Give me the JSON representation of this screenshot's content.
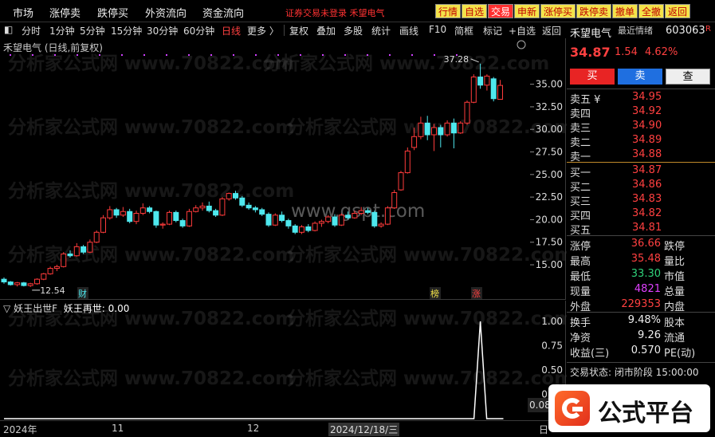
{
  "top_menu": [
    "市场",
    "涨停卖",
    "跌停买",
    "外资流向",
    "资金流向"
  ],
  "top_status": "证券交易未登录 禾望电气",
  "top_buttons": [
    {
      "label": "行情",
      "bg": "#f3e34a",
      "fg": "#c00000"
    },
    {
      "label": "自选",
      "bg": "#f3e34a",
      "fg": "#c00000"
    },
    {
      "label": "交易",
      "bg": "#ff3030",
      "fg": "#ffffff"
    },
    {
      "label": "申新",
      "bg": "#f3e34a",
      "fg": "#c00000"
    },
    {
      "label": "涨停买",
      "bg": "#f3e34a",
      "fg": "#c00000"
    },
    {
      "label": "跌停卖",
      "bg": "#f3e34a",
      "fg": "#c00000"
    },
    {
      "label": "撤单",
      "bg": "#f3e34a",
      "fg": "#c00000"
    },
    {
      "label": "全撤",
      "bg": "#f3e34a",
      "fg": "#c00000"
    },
    {
      "label": "返回",
      "bg": "#f3e34a",
      "fg": "#c00000"
    }
  ],
  "periods": [
    "分时",
    "1分钟",
    "5分钟",
    "15分钟",
    "30分钟",
    "60分钟",
    "日线",
    "更多 〉"
  ],
  "active_period": "日线",
  "tools": [
    "复权",
    "叠加",
    "多股",
    "统计",
    "画线",
    "F10",
    "简框",
    "标记",
    "+自选",
    "返回"
  ],
  "chart_title": "禾望电气 (日线,前复权)",
  "y_ticks": [
    "35.00",
    "32.50",
    "30.00",
    "27.50",
    "25.00",
    "22.50",
    "20.00",
    "17.50",
    "15.00"
  ],
  "max_label": "37.28",
  "min_label": "12.54",
  "markers": [
    {
      "text": "财",
      "color": "#4ee8ee"
    },
    {
      "text": "榜",
      "color": "#f3e34a"
    },
    {
      "text": "涨",
      "color": "#ff4040"
    }
  ],
  "indicator_title": "妖王出世F",
  "indicator_value": "妖王再世: 0.00",
  "ind_ticks": [
    "1.00",
    "0.75",
    "0.50",
    "0.25"
  ],
  "ind_bottom_value": "0.08",
  "x_labels": [
    "2024年",
    "11",
    "12",
    "2024/12/18/三"
  ],
  "x_suffix": "日",
  "watermark_1": "分析家公式网 www.70822.com",
  "watermark_2": "www.gspt.com",
  "panel": {
    "name": "禾望电气",
    "hint": "最近情绪",
    "code": "603063",
    "price": "34.87",
    "change": "1.54",
    "change_pct": "4.62%",
    "buy_btn": "买",
    "sell_btn": "卖",
    "query_btn": "查",
    "asks": [
      {
        "label": "卖五 ¥",
        "price": "34.95"
      },
      {
        "label": "卖四",
        "price": "34.92"
      },
      {
        "label": "卖三",
        "price": "34.90"
      },
      {
        "label": "卖二",
        "price": "34.89"
      },
      {
        "label": "卖一",
        "price": "34.88"
      }
    ],
    "bids": [
      {
        "label": "买一",
        "price": "34.87"
      },
      {
        "label": "买二",
        "price": "34.86"
      },
      {
        "label": "买三",
        "price": "34.83"
      },
      {
        "label": "买四",
        "price": "34.82"
      },
      {
        "label": "买五",
        "price": "34.81"
      }
    ],
    "stats": [
      {
        "label": "涨停",
        "value": "36.66",
        "color": "#ff4040",
        "label2": "跌停"
      },
      {
        "label": "最高",
        "value": "35.48",
        "color": "#ff4040",
        "label2": "量比"
      },
      {
        "label": "最低",
        "value": "33.30",
        "color": "#2fd27a",
        "label2": "市值"
      },
      {
        "label": "现量",
        "value": "4821",
        "color": "#e040ff",
        "label2": "总量"
      },
      {
        "label": "外盘",
        "value": "229353",
        "color": "#ff4040",
        "label2": "内盘"
      }
    ],
    "stats2": [
      {
        "label": "换手",
        "value": "9.48%",
        "label2": "股本"
      },
      {
        "label": "净资",
        "value": "9.26",
        "label2": "流通"
      },
      {
        "label": "收益(三)",
        "value": "0.570",
        "label2": "PE(动)"
      }
    ],
    "trade_status": "交易状态: 闭市阶段 15:00:00",
    "brand": "公式平台"
  },
  "chart_data": {
    "type": "candlestick",
    "title": "禾望电气 (日线,前复权)",
    "ylim": [
      12.0,
      38.5
    ],
    "candles": [
      {
        "o": 13.4,
        "c": 13.1,
        "h": 13.6,
        "l": 12.9
      },
      {
        "o": 13.1,
        "c": 12.8,
        "h": 13.2,
        "l": 12.7
      },
      {
        "o": 12.8,
        "c": 13.0,
        "h": 13.1,
        "l": 12.6
      },
      {
        "o": 13.0,
        "c": 12.7,
        "h": 13.1,
        "l": 12.6
      },
      {
        "o": 12.7,
        "c": 12.9,
        "h": 13.0,
        "l": 12.54
      },
      {
        "o": 12.9,
        "c": 13.4,
        "h": 13.5,
        "l": 12.8
      },
      {
        "o": 13.4,
        "c": 14.0,
        "h": 14.1,
        "l": 13.3
      },
      {
        "o": 14.0,
        "c": 14.6,
        "h": 14.8,
        "l": 13.9
      },
      {
        "o": 14.6,
        "c": 14.8,
        "h": 15.0,
        "l": 14.3
      },
      {
        "o": 14.8,
        "c": 16.2,
        "h": 16.4,
        "l": 14.7
      },
      {
        "o": 16.2,
        "c": 16.0,
        "h": 16.6,
        "l": 15.8
      },
      {
        "o": 16.0,
        "c": 17.0,
        "h": 17.4,
        "l": 15.9
      },
      {
        "o": 17.0,
        "c": 16.4,
        "h": 17.2,
        "l": 16.2
      },
      {
        "o": 16.4,
        "c": 17.5,
        "h": 17.8,
        "l": 16.3
      },
      {
        "o": 17.5,
        "c": 18.6,
        "h": 18.8,
        "l": 17.4
      },
      {
        "o": 18.6,
        "c": 20.2,
        "h": 20.5,
        "l": 18.5
      },
      {
        "o": 20.2,
        "c": 21.1,
        "h": 21.5,
        "l": 20.0
      },
      {
        "o": 21.1,
        "c": 20.5,
        "h": 21.3,
        "l": 20.2
      },
      {
        "o": 20.5,
        "c": 20.9,
        "h": 21.4,
        "l": 20.3
      },
      {
        "o": 20.9,
        "c": 19.8,
        "h": 21.2,
        "l": 19.6
      },
      {
        "o": 19.8,
        "c": 20.7,
        "h": 21.0,
        "l": 19.5
      },
      {
        "o": 20.7,
        "c": 21.3,
        "h": 21.8,
        "l": 20.5
      },
      {
        "o": 21.3,
        "c": 20.9,
        "h": 21.5,
        "l": 20.7
      },
      {
        "o": 20.9,
        "c": 19.4,
        "h": 21.0,
        "l": 19.1
      },
      {
        "o": 19.4,
        "c": 19.5,
        "h": 19.7,
        "l": 19.0
      },
      {
        "o": 19.5,
        "c": 20.8,
        "h": 21.0,
        "l": 19.4
      },
      {
        "o": 20.8,
        "c": 19.9,
        "h": 21.0,
        "l": 19.7
      },
      {
        "o": 19.9,
        "c": 19.3,
        "h": 20.1,
        "l": 19.1
      },
      {
        "o": 19.3,
        "c": 20.9,
        "h": 21.2,
        "l": 19.2
      },
      {
        "o": 20.9,
        "c": 21.3,
        "h": 21.6,
        "l": 20.8
      },
      {
        "o": 21.3,
        "c": 21.5,
        "h": 21.9,
        "l": 21.0
      },
      {
        "o": 21.5,
        "c": 21.0,
        "h": 22.0,
        "l": 20.8
      },
      {
        "o": 21.0,
        "c": 20.5,
        "h": 21.2,
        "l": 20.3
      },
      {
        "o": 20.5,
        "c": 22.3,
        "h": 22.5,
        "l": 20.4
      },
      {
        "o": 22.3,
        "c": 22.9,
        "h": 23.0,
        "l": 22.1
      },
      {
        "o": 22.9,
        "c": 22.4,
        "h": 23.2,
        "l": 22.2
      },
      {
        "o": 22.4,
        "c": 21.6,
        "h": 22.6,
        "l": 21.4
      },
      {
        "o": 21.6,
        "c": 21.3,
        "h": 21.9,
        "l": 21.1
      },
      {
        "o": 21.3,
        "c": 21.1,
        "h": 21.5,
        "l": 20.8
      },
      {
        "o": 21.1,
        "c": 20.6,
        "h": 21.3,
        "l": 20.4
      },
      {
        "o": 20.6,
        "c": 19.4,
        "h": 20.8,
        "l": 19.2
      },
      {
        "o": 19.4,
        "c": 20.5,
        "h": 20.7,
        "l": 19.3
      },
      {
        "o": 20.5,
        "c": 19.9,
        "h": 20.9,
        "l": 19.7
      },
      {
        "o": 19.9,
        "c": 19.3,
        "h": 20.1,
        "l": 19.0
      },
      {
        "o": 19.3,
        "c": 18.6,
        "h": 19.5,
        "l": 18.4
      },
      {
        "o": 18.6,
        "c": 19.2,
        "h": 19.4,
        "l": 18.4
      },
      {
        "o": 19.2,
        "c": 18.8,
        "h": 19.5,
        "l": 18.6
      },
      {
        "o": 18.8,
        "c": 19.6,
        "h": 19.8,
        "l": 18.7
      },
      {
        "o": 19.6,
        "c": 19.8,
        "h": 20.0,
        "l": 19.2
      },
      {
        "o": 19.8,
        "c": 20.3,
        "h": 20.5,
        "l": 19.6
      },
      {
        "o": 20.3,
        "c": 19.4,
        "h": 20.6,
        "l": 19.2
      },
      {
        "o": 19.4,
        "c": 20.5,
        "h": 20.7,
        "l": 19.3
      },
      {
        "o": 20.5,
        "c": 20.2,
        "h": 20.9,
        "l": 20.0
      },
      {
        "o": 20.2,
        "c": 20.7,
        "h": 21.0,
        "l": 20.1
      },
      {
        "o": 20.7,
        "c": 21.0,
        "h": 21.4,
        "l": 20.5
      },
      {
        "o": 21.0,
        "c": 20.8,
        "h": 21.3,
        "l": 20.6
      },
      {
        "o": 20.8,
        "c": 19.3,
        "h": 21.0,
        "l": 19.1
      },
      {
        "o": 19.3,
        "c": 19.5,
        "h": 19.7,
        "l": 19.1
      },
      {
        "o": 19.5,
        "c": 21.3,
        "h": 21.5,
        "l": 19.4
      },
      {
        "o": 21.3,
        "c": 23.0,
        "h": 23.3,
        "l": 21.2
      },
      {
        "o": 23.3,
        "c": 25.2,
        "h": 25.4,
        "l": 23.2
      },
      {
        "o": 25.2,
        "c": 27.6,
        "h": 28.0,
        "l": 25.1
      },
      {
        "o": 28.0,
        "c": 29.2,
        "h": 30.2,
        "l": 27.7
      },
      {
        "o": 29.2,
        "c": 30.7,
        "h": 31.4,
        "l": 28.9
      },
      {
        "o": 30.7,
        "c": 29.4,
        "h": 31.5,
        "l": 28.8
      },
      {
        "o": 29.4,
        "c": 30.2,
        "h": 30.6,
        "l": 27.6
      },
      {
        "o": 30.2,
        "c": 29.4,
        "h": 30.5,
        "l": 28.0
      },
      {
        "o": 29.4,
        "c": 30.7,
        "h": 31.0,
        "l": 29.2
      },
      {
        "o": 30.7,
        "c": 29.6,
        "h": 31.2,
        "l": 27.9
      },
      {
        "o": 29.6,
        "c": 30.7,
        "h": 30.9,
        "l": 29.5
      },
      {
        "o": 30.7,
        "c": 33.0,
        "h": 33.2,
        "l": 30.5
      },
      {
        "o": 33.0,
        "c": 35.8,
        "h": 36.1,
        "l": 32.9
      },
      {
        "o": 35.8,
        "c": 34.9,
        "h": 37.28,
        "l": 34.5
      },
      {
        "o": 34.9,
        "c": 35.9,
        "h": 36.1,
        "l": 34.3
      },
      {
        "o": 35.6,
        "c": 33.4,
        "h": 35.8,
        "l": 33.1
      },
      {
        "o": 33.33,
        "c": 34.87,
        "h": 35.48,
        "l": 33.3
      }
    ],
    "indicator": {
      "name": "妖王再世",
      "ylim": [
        0,
        1.05
      ],
      "spike_index": 72,
      "values_note": "0 everywhere except 1.00 at one bar"
    }
  }
}
